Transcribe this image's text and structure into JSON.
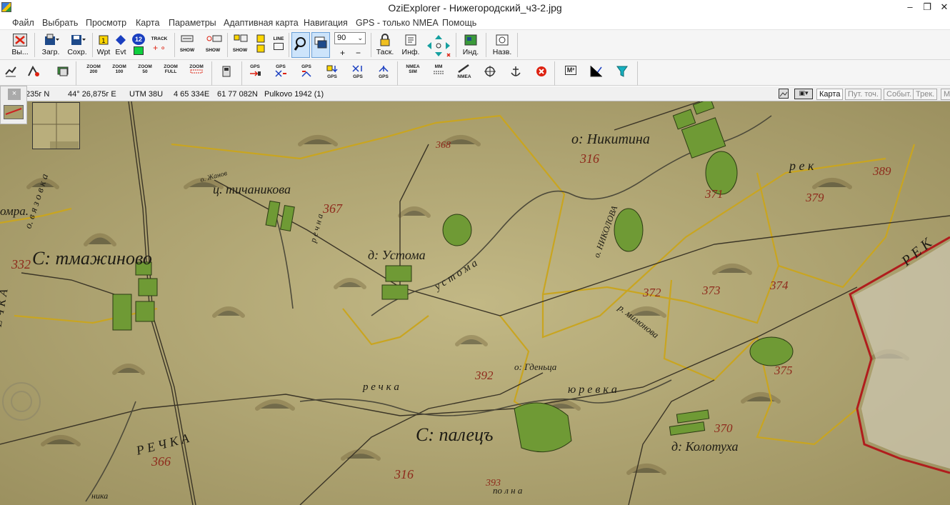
{
  "window": {
    "title": "OziExplorer - Нижегородский_ч3-2.jpg",
    "minimize": "–",
    "maximize": "❐",
    "close": "✕"
  },
  "menu": [
    "Файл",
    "Выбрать",
    "Просмотр",
    "Карта",
    "Параметры",
    "Адаптивная карта",
    "Навигация",
    "GPS - только NMEA",
    "Помощь"
  ],
  "toolbar": {
    "exit_label": "Вы...",
    "load_label": "Загр.",
    "save_label": "Сохр.",
    "wpt_label": "Wpt",
    "evt_label": "Evt",
    "badge_12": "12",
    "track_label": "TRACK",
    "show_label": "SHOW",
    "zoom_value": "90",
    "tack_label": "Таск.",
    "info_label": "Инф.",
    "ind_label": "Инд.",
    "name_label": "Назв."
  },
  "toolbar2": {
    "zoom200": "ZOOM 200",
    "zoom100": "ZOOM 100",
    "zoom50": "ZOOM 50",
    "zoomfull": "ZOOM FULL",
    "zoom": "ZOOM",
    "gps1": "GPS",
    "gps2": "GPS",
    "gps3": "GPS",
    "gps4": "GPS",
    "gps5": "GPS",
    "gps6": "GPS",
    "nmea_sim": "NMEA SIM",
    "mm": "MM",
    "nmea": "NMEA",
    "m2": "M²"
  },
  "status": {
    "lat": "235г N",
    "lon": "44° 26,875г E",
    "utm": "UTM  38U",
    "easting": "4 65 334E",
    "northing": "61 77 082N",
    "datum": "Pulkovo 1942 (1)"
  },
  "right_tabs": [
    "Карта",
    "Пут. точ.",
    "Событ.",
    "Трек.",
    "М"
  ],
  "side_close": "×",
  "map_labels": {
    "tmazhinovo": "С: тмажиново",
    "tichanikova": "ц. тичаникова",
    "ustoma": "д: Устома",
    "nikitina": "о: Никитина",
    "palets": "С: палецъ",
    "kolotukha": "д: Колотуха",
    "yurevka": "ю р е в к а",
    "rechka": "р е ч к а",
    "ustoma_river": "у с т о м а",
    "vyazovka": "о. в я з о в к а",
    "rechka2": "Р Е Ч К А",
    "mra": "омра.",
    "reka": "р е к",
    "reka2": "Р Е К",
    "ozhanov": "о. Жанов",
    "rechna": "р е ч н а",
    "nikolova": "о. НИКОЛОВА",
    "mimenova": "р. мимонова",
    "ogdentsa": "о: Гденьца",
    "nikima": "ника",
    "polna": "по л н а",
    "rechka3": "Р Е Ч К А"
  },
  "map_numbers": {
    "n332": "332",
    "n367": "367",
    "n316a": "316",
    "n371": "371",
    "n379": "379",
    "n389": "389",
    "n372": "372",
    "n373": "373",
    "n374": "374",
    "n375": "375",
    "n370": "370",
    "n392": "392",
    "n366": "366",
    "n316b": "316",
    "n393": "393",
    "n368": "368"
  }
}
